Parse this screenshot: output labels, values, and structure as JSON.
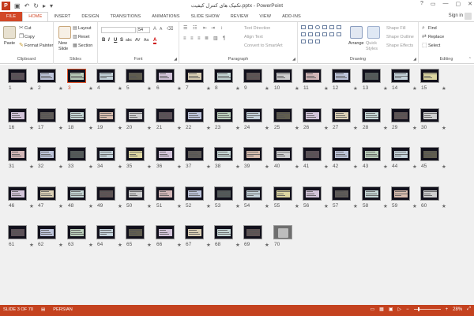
{
  "window": {
    "title": "تکنیک های کنترل کیفیت.pptx - PowerPoint",
    "controls": [
      "?",
      "▭",
      "—",
      "▢",
      "✕"
    ]
  },
  "tabs": [
    {
      "label": "FILE"
    },
    {
      "label": "HOME"
    },
    {
      "label": "INSERT"
    },
    {
      "label": "DESIGN"
    },
    {
      "label": "TRANSITIONS"
    },
    {
      "label": "ANIMATIONS"
    },
    {
      "label": "SLIDE SHOW"
    },
    {
      "label": "REVIEW"
    },
    {
      "label": "VIEW"
    },
    {
      "label": "ADD-INS"
    }
  ],
  "signin": "Sign in",
  "ribbon": {
    "clipboard": {
      "label": "Clipboard",
      "paste": "Paste",
      "cut": "Cut",
      "copy": "Copy",
      "format_painter": "Format Painter"
    },
    "slides": {
      "label": "Slides",
      "new_slide": "New",
      "new_slide2": "Slide",
      "layout": "Layout",
      "reset": "Reset",
      "section": "Section"
    },
    "font": {
      "label": "Font",
      "size": "54",
      "styles": [
        "B",
        "I",
        "U",
        "S",
        "abc",
        "AV",
        "Aa",
        "A"
      ]
    },
    "paragraph": {
      "label": "Paragraph",
      "text_direction": "Text Direction",
      "align_text": "Align Text",
      "convert_smartart": "Convert to SmartArt"
    },
    "drawing": {
      "label": "Drawing",
      "arrange": "Arrange",
      "quick_styles": "Quick Styles",
      "shape_fill": "Shape Fill",
      "shape_outline": "Shape Outline",
      "shape_effects": "Shape Effects"
    },
    "editing": {
      "label": "Editing",
      "find": "Find",
      "replace": "Replace",
      "select": "Select"
    }
  },
  "slides": {
    "selected": 3,
    "numbers": [
      "1",
      "2",
      "3",
      "4",
      "5",
      "6",
      "7",
      "8",
      "9",
      "10",
      "11",
      "12",
      "13",
      "14",
      "15",
      "16",
      "17",
      "18",
      "19",
      "20",
      "21",
      "22",
      "23",
      "24",
      "25",
      "26",
      "27",
      "28",
      "29",
      "30",
      "31",
      "32",
      "33",
      "34",
      "35",
      "36",
      "37",
      "38",
      "39",
      "40",
      "41",
      "42",
      "43",
      "44",
      "45",
      "46",
      "47",
      "48",
      "49",
      "50",
      "51",
      "52",
      "53",
      "54",
      "55",
      "56",
      "57",
      "58",
      "59",
      "60",
      "61",
      "62",
      "63",
      "64",
      "65",
      "66",
      "67",
      "68",
      "69",
      "70"
    ],
    "star": "★",
    "bands": [
      "#e8c9c9",
      "#d8e8f0",
      "#f2e6c8",
      "#e3e3e3",
      "#cde3cd",
      "#e8d8ee",
      "#f0d0c0",
      "#d0d8f0",
      "#f4ecb0",
      "#d9ecea"
    ]
  },
  "status": {
    "slide_info": "SLIDE 3 OF 70",
    "language": "PERSIAN",
    "zoom": "28%"
  }
}
